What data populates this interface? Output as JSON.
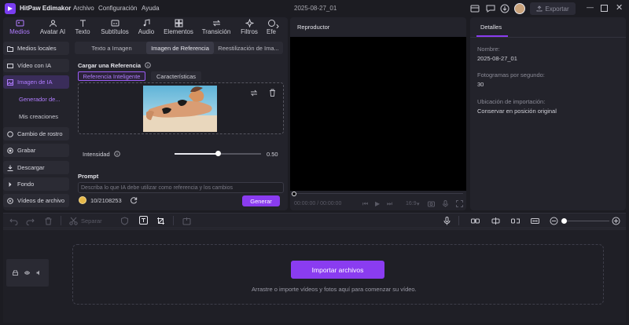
{
  "app": {
    "name": "HitPaw Edimakor",
    "menu": [
      "Archivo",
      "Configuración",
      "Ayuda"
    ],
    "project_title": "2025-08-27_01",
    "export_label": "Exportar"
  },
  "top_tabs": [
    {
      "label": "Medios",
      "icon": "media-icon",
      "active": true
    },
    {
      "label": "Avatar AI",
      "icon": "avatar-icon",
      "active": false
    },
    {
      "label": "Texto",
      "icon": "text-icon",
      "active": false
    },
    {
      "label": "Subtítulos",
      "icon": "subtitles-icon",
      "active": false
    },
    {
      "label": "Audio",
      "icon": "audio-icon",
      "active": false
    },
    {
      "label": "Elementos",
      "icon": "elements-icon",
      "active": false
    },
    {
      "label": "Transición",
      "icon": "transition-icon",
      "active": false
    },
    {
      "label": "Filtros",
      "icon": "filters-icon",
      "active": false
    },
    {
      "label": "Efe",
      "icon": "effects-icon",
      "active": false
    }
  ],
  "sidebar": {
    "items": [
      {
        "label": "Medios locales",
        "icon": "folder-icon"
      },
      {
        "label": "Vídeo con IA",
        "icon": "video-ai-icon"
      },
      {
        "label": "Imagen de IA",
        "icon": "image-ai-icon",
        "active": true
      },
      {
        "label": "Cambio de rostro",
        "icon": "face-swap-icon"
      },
      {
        "label": "Grabar",
        "icon": "record-icon"
      },
      {
        "label": "Descargar",
        "icon": "download-icon"
      },
      {
        "label": "Fondo",
        "icon": "background-icon"
      },
      {
        "label": "Vídeos de archivo",
        "icon": "stock-video-icon"
      }
    ],
    "sub_items": [
      {
        "label": "Generador de...",
        "active": true
      },
      {
        "label": "Mis creaciones",
        "active": false
      }
    ]
  },
  "sub_tabs": [
    "Texto a Imagen",
    "Imagen de Referencia",
    "Reestilización de Ima..."
  ],
  "reference": {
    "section_title": "Cargar una Referencia",
    "tabs": [
      "Referencia Inteligente",
      "Características"
    ],
    "intensity_label": "Intensidad",
    "intensity_value": "0.50",
    "intensity_fraction": 0.5
  },
  "prompt": {
    "label": "Prompt",
    "placeholder": "Describa lo que IA debe utilizar como referencia y los cambios",
    "credits": "10/2108253",
    "generate_label": "Generar"
  },
  "player": {
    "title": "Reproductor",
    "time": "00:00:00 / 00:00:00",
    "ratio": "16:9"
  },
  "details": {
    "tab": "Detalles",
    "fields": [
      {
        "label": "Nombre:",
        "value": "2025-08-27_01"
      },
      {
        "label": "Fotogramas por segundo:",
        "value": "30"
      },
      {
        "label": "Ubicación de importación:",
        "value": "Conservar en posición original"
      }
    ]
  },
  "timeline": {
    "split_label": "Separar",
    "import_label": "Importar archivos",
    "hint": "Arrastre o importe vídeos y fotos aquí para comenzar su vídeo."
  },
  "colors": {
    "accent": "#8a3cf0",
    "accent_text": "#b07cff",
    "bg": "#1c1c22",
    "panel": "#23232b"
  }
}
